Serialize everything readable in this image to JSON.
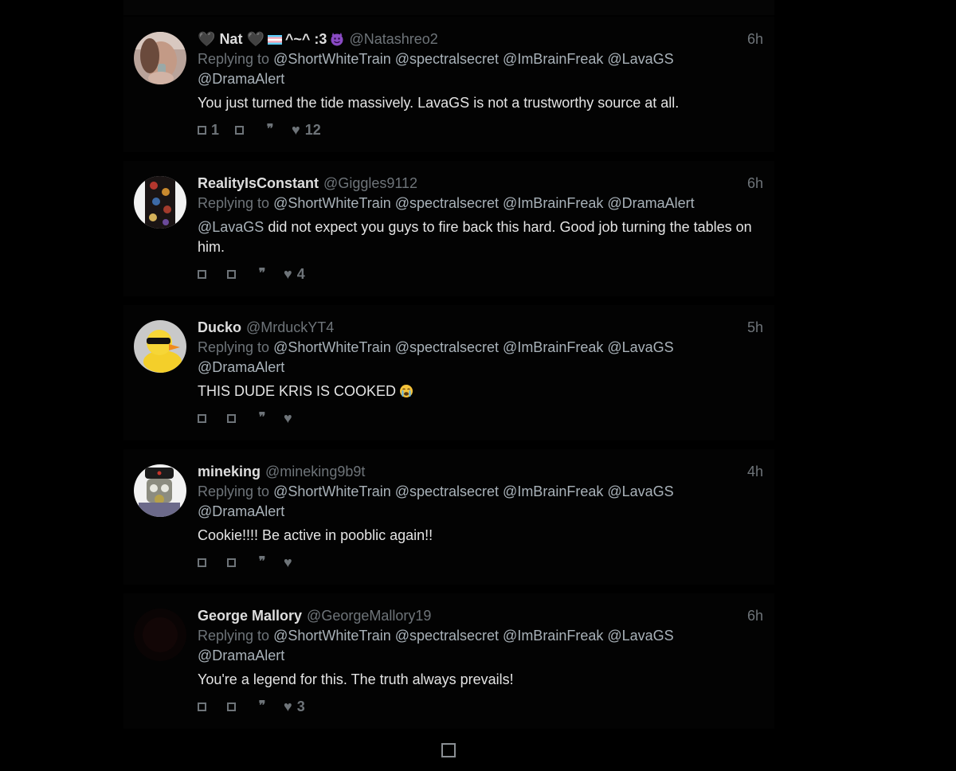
{
  "replies": [
    {
      "name_prefix_icon": "black-heart-icon",
      "display_name": "Nat",
      "name_mid_icon": "black-heart-icon",
      "name_flag_icon": "trans-flag-icon",
      "name_suffix": "^~^ :3",
      "name_end_icon": "smiling-devil-icon",
      "handle": "@Natashreo2",
      "timestamp": "6h",
      "replying_label": "Replying to",
      "mentions_line1": "@ShortWhiteTrain @spectralsecret @ImBrainFreak @LavaGS",
      "mentions_line2": "@DramaAlert",
      "text": "You just turned the tide massively. LavaGS is not a trustworthy source at all.",
      "reply_count": "1",
      "retweet_count": "",
      "like_count": "12"
    },
    {
      "display_name": "RealityIsConstant",
      "handle": "@Giggles9112",
      "timestamp": "6h",
      "replying_label": "Replying to",
      "mentions_line1": "@ShortWhiteTrain @spectralsecret @ImBrainFreak @DramaAlert",
      "text_mention": "@LavaGS",
      "text": " did not expect you guys to fire back this hard. Good job turning the tables on him.",
      "reply_count": "",
      "retweet_count": "",
      "like_count": "4"
    },
    {
      "display_name": "Ducko",
      "handle": "@MrduckYT4",
      "timestamp": "5h",
      "replying_label": "Replying to",
      "mentions_line1": "@ShortWhiteTrain @spectralsecret @ImBrainFreak @LavaGS",
      "mentions_line2": "@DramaAlert",
      "text": "THIS DUDE KRIS IS COOKED",
      "text_end_icon": "crying-face-icon",
      "reply_count": "",
      "retweet_count": "",
      "like_count": ""
    },
    {
      "display_name": "mineking",
      "handle": "@mineking9b9t",
      "timestamp": "4h",
      "replying_label": "Replying to",
      "mentions_line1": "@ShortWhiteTrain @spectralsecret @ImBrainFreak @LavaGS",
      "mentions_line2": "@DramaAlert",
      "text": "Cookie!!!! Be active in pooblic again!!",
      "reply_count": "",
      "retweet_count": "",
      "like_count": ""
    },
    {
      "display_name": "George Mallory",
      "handle": "@GeorgeMallory19",
      "timestamp": "6h",
      "replying_label": "Replying to",
      "mentions_line1": "@ShortWhiteTrain @spectralsecret @ImBrainFreak @LavaGS",
      "mentions_line2": "@DramaAlert",
      "text": "You're a legend for this. The truth always prevails!",
      "reply_count": "",
      "retweet_count": "",
      "like_count": "3"
    }
  ],
  "action_icons": {
    "reply": "reply-icon",
    "retweet": "retweet-icon",
    "quote": "quote-icon",
    "like": "heart-icon",
    "quote_glyph": "❞",
    "heart_glyph": "♥"
  },
  "load_more_icon": "load-more-icon",
  "colors": {
    "background": "#000000",
    "card": "#030303",
    "name": "#dedede",
    "muted": "#6e7479",
    "mention": "#a9b2b9",
    "text": "#e4e4e4"
  }
}
